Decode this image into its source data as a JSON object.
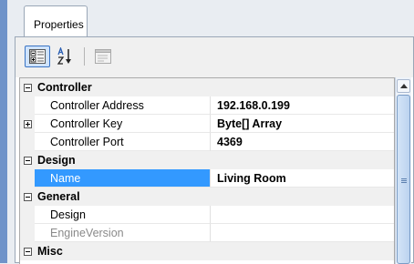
{
  "tab": {
    "label": "Properties"
  },
  "toolbar": {
    "buttons": [
      {
        "icon": "categorized-icon",
        "active": true
      },
      {
        "icon": "sort-alphabetical-icon",
        "active": false
      },
      {
        "icon": "property-pages-icon",
        "active": false,
        "disabled": true
      }
    ]
  },
  "grid": {
    "categories": [
      {
        "name": "Controller",
        "expanded": true,
        "properties": [
          {
            "name": "Controller Address",
            "value": "192.168.0.199"
          },
          {
            "name": "Controller Key",
            "value": "Byte[] Array",
            "expandable": true
          },
          {
            "name": "Controller Port",
            "value": "4369"
          }
        ]
      },
      {
        "name": "Design",
        "expanded": true,
        "properties": [
          {
            "name": "Name",
            "value": "Living Room",
            "selected": true
          }
        ]
      },
      {
        "name": "General",
        "expanded": true,
        "properties": [
          {
            "name": "Design",
            "value": ""
          },
          {
            "name": "EngineVersion",
            "value": "",
            "greyed": true
          }
        ]
      },
      {
        "name": "Misc",
        "expanded": true,
        "properties": []
      }
    ]
  },
  "colors": {
    "selection": "#3399ff",
    "category_bg": "#f0f0f0",
    "accent_strip": "#6f93c9"
  }
}
